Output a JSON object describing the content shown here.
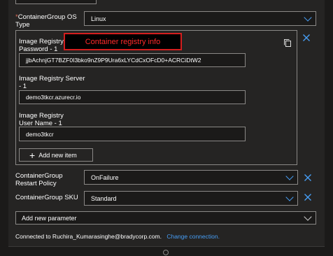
{
  "os_type": {
    "label_prefix": "*",
    "label": "ContainerGroup OS Type",
    "value": "Linux"
  },
  "callout": {
    "text": "Container registry info"
  },
  "registry_password": {
    "label": "Image Registry Password - 1",
    "value": "jjbAchnjGT7BZF0I3bko9nZ9P9Ura6xLYCdCxOFcD0+ACRCiDtW2"
  },
  "registry_server": {
    "label": "Image Registry Server - 1",
    "value": "demo3tkcr.azurecr.io"
  },
  "registry_user": {
    "label": "Image Registry User Name - 1",
    "value": "demo3tkcr"
  },
  "add_item": {
    "label": "Add new item"
  },
  "restart_policy": {
    "label": "ContainerGroup Restart Policy",
    "value": "OnFailure"
  },
  "sku": {
    "label": "ContainerGroup SKU",
    "value": "Standard"
  },
  "add_param": {
    "label": "Add new parameter"
  },
  "footer": {
    "connected_text": "Connected to Ruchira_Kumarasinghe@bradycorp.com.",
    "change_link": "Change connection."
  },
  "colors": {
    "accent": "#479ef5",
    "callout_border": "#d41e1e",
    "callout_text": "#ff2a2a",
    "background": "#252423"
  },
  "icons": [
    "close-icon",
    "copy-icon",
    "chevron-down-icon",
    "plus-icon"
  ]
}
